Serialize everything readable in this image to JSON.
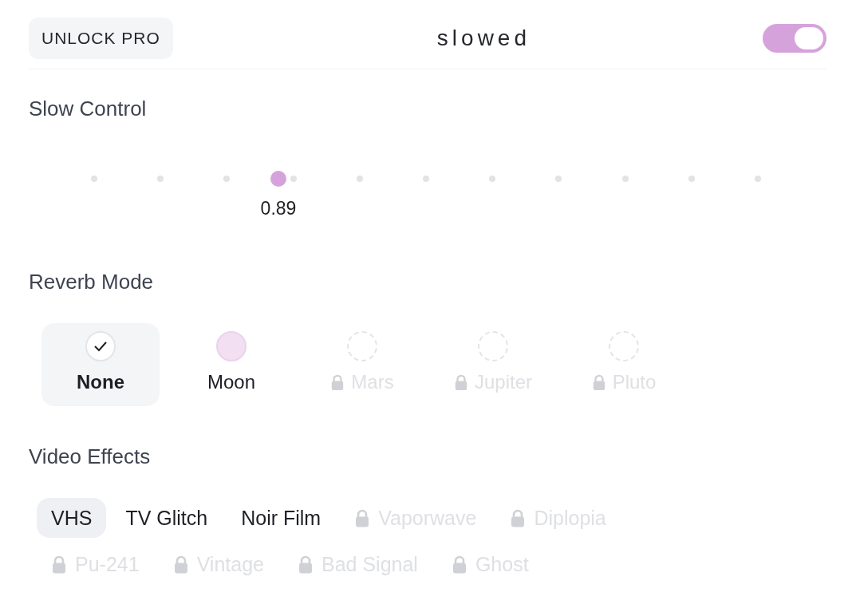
{
  "header": {
    "unlock_button": "UNLOCK PRO",
    "title": "slowed",
    "toggle": {
      "on": true
    }
  },
  "slow_control": {
    "title": "Slow Control",
    "slider": {
      "level": 0.275,
      "reading": "0.89"
    }
  },
  "reverb_mode": {
    "title": "Reverb Mode",
    "options": [
      {
        "label": "None",
        "selected": true,
        "locked": false
      },
      {
        "label": "Moon",
        "selected": false,
        "locked": false
      },
      {
        "label": "Mars",
        "selected": false,
        "locked": true
      },
      {
        "label": "Jupiter",
        "selected": false,
        "locked": true
      },
      {
        "label": "Pluto",
        "selected": false,
        "locked": true
      }
    ]
  },
  "video_effects": {
    "title": "Video Effects",
    "effects": [
      {
        "label": "VHS",
        "selected": true,
        "locked": false
      },
      {
        "label": "TV Glitch",
        "selected": false,
        "locked": false
      },
      {
        "label": "Noir Film",
        "selected": false,
        "locked": false
      },
      {
        "label": "Vaporwave",
        "selected": false,
        "locked": true
      },
      {
        "label": "Diplopia",
        "selected": false,
        "locked": true
      },
      {
        "label": "Pu-241",
        "selected": false,
        "locked": true
      },
      {
        "label": "Vintage",
        "selected": false,
        "locked": true
      },
      {
        "label": "Bad Signal",
        "selected": false,
        "locked": true
      },
      {
        "label": "Ghost",
        "selected": false,
        "locked": true
      }
    ]
  }
}
